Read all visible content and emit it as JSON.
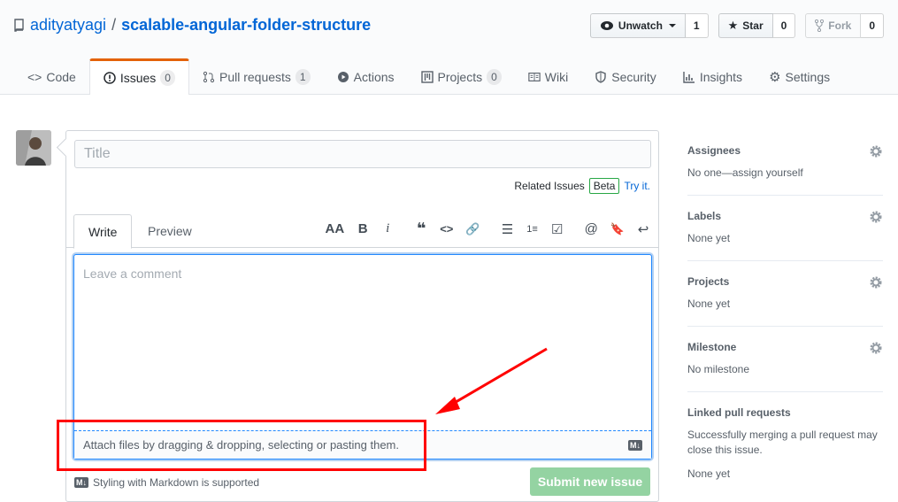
{
  "repo": {
    "owner": "adityatyagi",
    "separator": "/",
    "name": "scalable-angular-folder-structure"
  },
  "actions": [
    {
      "label": "Unwatch",
      "count": "1",
      "icon": "eye-icon"
    },
    {
      "label": "Star",
      "count": "0",
      "icon": "star-icon"
    },
    {
      "label": "Fork",
      "count": "0",
      "icon": "fork-icon"
    }
  ],
  "tabs": [
    {
      "label": "Code",
      "icon": "code-icon"
    },
    {
      "label": "Issues",
      "count": "0",
      "icon": "issue-icon"
    },
    {
      "label": "Pull requests",
      "count": "1",
      "icon": "pull-request-icon"
    },
    {
      "label": "Actions",
      "icon": "play-icon"
    },
    {
      "label": "Projects",
      "count": "0",
      "icon": "project-icon"
    },
    {
      "label": "Wiki",
      "icon": "book-icon"
    },
    {
      "label": "Security",
      "icon": "shield-icon"
    },
    {
      "label": "Insights",
      "icon": "graph-icon"
    },
    {
      "label": "Settings",
      "icon": "gear-icon"
    }
  ],
  "issue_form": {
    "title_placeholder": "Title",
    "related_label": "Related Issues",
    "beta": "Beta",
    "try_it": "Try it.",
    "write_tab": "Write",
    "preview_tab": "Preview",
    "comment_placeholder": "Leave a comment",
    "attach_text": "Attach files by dragging & dropping, selecting or pasting them.",
    "markdown_note": "Styling with Markdown is supported",
    "markdown_badge": "M↓",
    "submit_label": "Submit new issue"
  },
  "toolbar": [
    "AA",
    "B",
    "i",
    "❝",
    "<>",
    "🔗",
    "☰",
    "1≡",
    "☑",
    "@",
    "🔖",
    "↩"
  ],
  "sidebar": [
    {
      "heading": "Assignees",
      "value": "No one—assign yourself",
      "gear": true
    },
    {
      "heading": "Labels",
      "value": "None yet",
      "gear": true
    },
    {
      "heading": "Projects",
      "value": "None yet",
      "gear": true
    },
    {
      "heading": "Milestone",
      "value": "No milestone",
      "gear": true
    },
    {
      "heading": "Linked pull requests",
      "value": "Successfully merging a pull request may close this issue.",
      "value2": "None yet",
      "gear": false
    }
  ],
  "annotation_color": "#ff0000"
}
